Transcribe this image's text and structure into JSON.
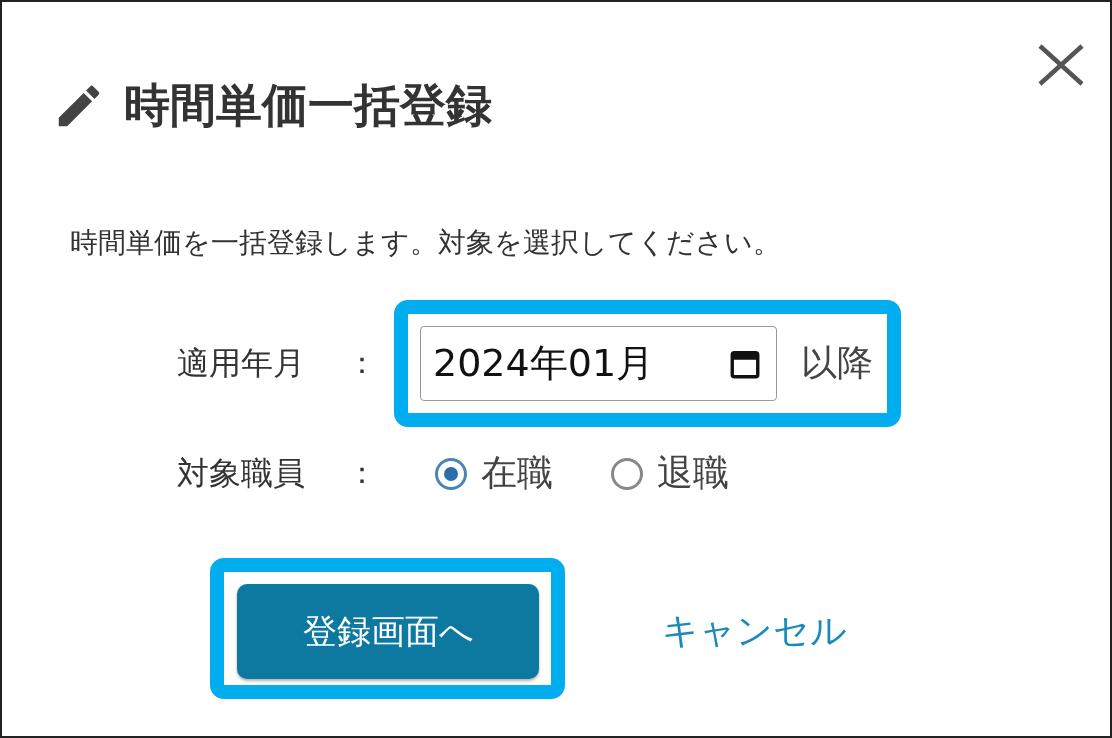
{
  "dialog": {
    "title": "時間単価一括登録",
    "description": "時間単価を一括登録します。対象を選択してください。",
    "fields": [
      {
        "kind": "date",
        "label": "適用年月",
        "separator": "：",
        "value": "2024年01月",
        "suffix": "以降",
        "highlighted": true
      },
      {
        "kind": "radio",
        "label": "対象職員",
        "separator": "：",
        "options": [
          {
            "label": "在職",
            "selected": true
          },
          {
            "label": "退職",
            "selected": false
          }
        ]
      }
    ],
    "buttons": [
      {
        "kind": "primary",
        "label": "登録画面へ",
        "highlighted": true
      },
      {
        "kind": "link",
        "label": "キャンセル",
        "highlighted": false
      }
    ]
  }
}
